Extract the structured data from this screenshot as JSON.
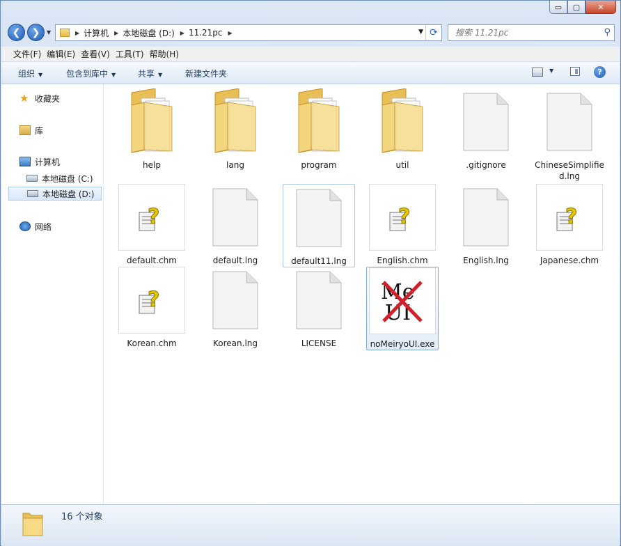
{
  "window": {
    "caption_buttons": {
      "minimize": "▭",
      "maximize": "▢",
      "close": "✕"
    }
  },
  "address": {
    "crumbs": [
      "计算机",
      "本地磁盘 (D:)",
      "11.21pc"
    ]
  },
  "search": {
    "placeholder": "搜索 11.21pc"
  },
  "menu": [
    "文件(F)",
    "编辑(E)",
    "查看(V)",
    "工具(T)",
    "帮助(H)"
  ],
  "toolbar": {
    "organize": "组织",
    "include_library": "包含到库中",
    "share": "共享",
    "new_folder": "新建文件夹"
  },
  "navpane": {
    "favorites": "收藏夹",
    "libraries": "库",
    "computer": "计算机",
    "drive_c": "本地磁盘 (C:)",
    "drive_d": "本地磁盘 (D:)",
    "network": "网络"
  },
  "files": [
    {
      "name": "help",
      "type": "folder"
    },
    {
      "name": "lang",
      "type": "folder"
    },
    {
      "name": "program",
      "type": "folder"
    },
    {
      "name": "util",
      "type": "folder"
    },
    {
      "name": ".gitignore",
      "type": "file"
    },
    {
      "name": "ChineseSimplified.lng",
      "type": "file"
    },
    {
      "name": "default.chm",
      "type": "chm"
    },
    {
      "name": "default.lng",
      "type": "file"
    },
    {
      "name": "default11.lng",
      "type": "file"
    },
    {
      "name": "English.chm",
      "type": "chm"
    },
    {
      "name": "English.lng",
      "type": "file"
    },
    {
      "name": "Japanese.chm",
      "type": "chm"
    },
    {
      "name": "Korean.chm",
      "type": "chm"
    },
    {
      "name": "Korean.lng",
      "type": "file"
    },
    {
      "name": "LICENSE",
      "type": "file"
    },
    {
      "name": "noMeiryoUI.exe",
      "type": "exe"
    }
  ],
  "exe_icon_text": {
    "line1": "Me",
    "line2": "UI"
  },
  "status": {
    "count": "16 个对象"
  }
}
